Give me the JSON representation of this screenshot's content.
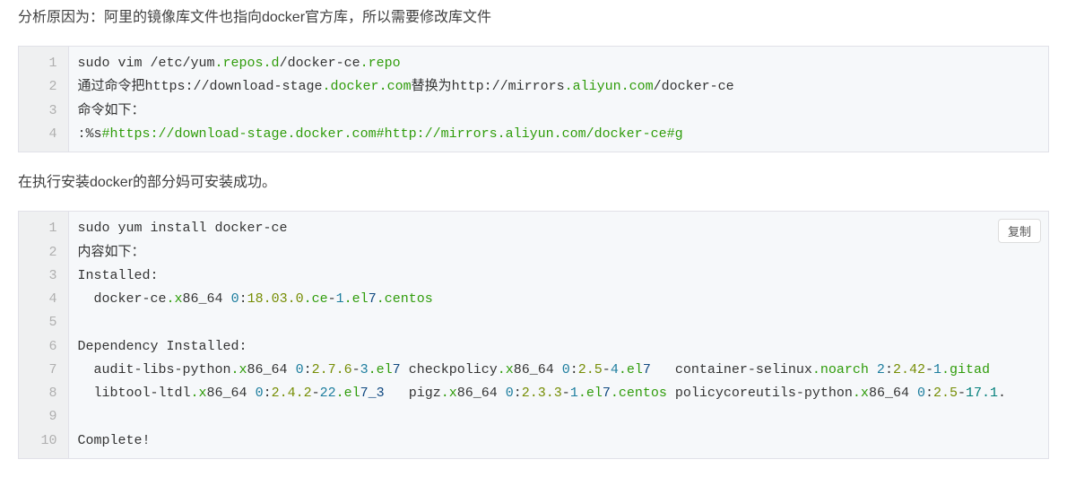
{
  "para1": "分析原因为：阿里的镜像库文件也指向docker官方库，所以需要修改库文件",
  "para2": "在执行安装docker的部分妈可安装成功。",
  "copy_label": "复制",
  "block1": {
    "lines": [
      [
        {
          "t": "sudo vim /etc/yum"
        },
        {
          "t": ".repos",
          "c": "t-green"
        },
        {
          "t": ".d",
          "c": "t-green"
        },
        {
          "t": "/docker-ce"
        },
        {
          "t": ".repo",
          "c": "t-green"
        }
      ],
      [
        {
          "t": "通过命令把https://download-stage"
        },
        {
          "t": ".docker",
          "c": "t-green"
        },
        {
          "t": ".com",
          "c": "t-green"
        },
        {
          "t": "替换为http://mirrors"
        },
        {
          "t": ".aliyun",
          "c": "t-green"
        },
        {
          "t": ".com",
          "c": "t-green"
        },
        {
          "t": "/docker-ce"
        }
      ],
      [
        {
          "t": "命令如下："
        }
      ],
      [
        {
          "t": ":%s"
        },
        {
          "t": "#https://download-stage.docker.com#http://mirrors.aliyun.com/docker-ce#g",
          "c": "t-comment"
        }
      ]
    ]
  },
  "block2": {
    "lines": [
      [
        {
          "t": "sudo yum install docker-ce"
        }
      ],
      [
        {
          "t": "内容如下："
        }
      ],
      [
        {
          "t": "Installed:"
        }
      ],
      [
        {
          "t": "  docker-ce"
        },
        {
          "t": ".x",
          "c": "t-green"
        },
        {
          "t": "86_64 "
        },
        {
          "t": "0",
          "c": "t-num"
        },
        {
          "t": ":"
        },
        {
          "t": "18.03",
          "c": "t-olive"
        },
        {
          "t": ".0",
          "c": "t-olive"
        },
        {
          "t": ".ce",
          "c": "t-green"
        },
        {
          "t": "-"
        },
        {
          "t": "1",
          "c": "t-num"
        },
        {
          "t": ".el",
          "c": "t-green"
        },
        {
          "t": "7",
          "c": "t-navy"
        },
        {
          "t": ".centos",
          "c": "t-green"
        }
      ],
      [
        {
          "t": " "
        }
      ],
      [
        {
          "t": "Dependency Installed:"
        }
      ],
      [
        {
          "t": "  audit-libs-python"
        },
        {
          "t": ".x",
          "c": "t-green"
        },
        {
          "t": "86_64 "
        },
        {
          "t": "0",
          "c": "t-num"
        },
        {
          "t": ":"
        },
        {
          "t": "2.7",
          "c": "t-olive"
        },
        {
          "t": ".6",
          "c": "t-olive"
        },
        {
          "t": "-"
        },
        {
          "t": "3",
          "c": "t-num"
        },
        {
          "t": ".el",
          "c": "t-green"
        },
        {
          "t": "7",
          "c": "t-navy"
        },
        {
          "t": " checkpolicy"
        },
        {
          "t": ".x",
          "c": "t-green"
        },
        {
          "t": "86_64 "
        },
        {
          "t": "0",
          "c": "t-num"
        },
        {
          "t": ":"
        },
        {
          "t": "2.5",
          "c": "t-olive"
        },
        {
          "t": "-"
        },
        {
          "t": "4",
          "c": "t-num"
        },
        {
          "t": ".el",
          "c": "t-green"
        },
        {
          "t": "7",
          "c": "t-navy"
        },
        {
          "t": "   container-selinux"
        },
        {
          "t": ".noarch",
          "c": "t-green"
        },
        {
          "t": " "
        },
        {
          "t": "2",
          "c": "t-num"
        },
        {
          "t": ":"
        },
        {
          "t": "2.42",
          "c": "t-olive"
        },
        {
          "t": "-"
        },
        {
          "t": "1",
          "c": "t-num"
        },
        {
          "t": ".gitad",
          "c": "t-green"
        }
      ],
      [
        {
          "t": "  libtool-ltdl"
        },
        {
          "t": ".x",
          "c": "t-green"
        },
        {
          "t": "86_64 "
        },
        {
          "t": "0",
          "c": "t-num"
        },
        {
          "t": ":"
        },
        {
          "t": "2.4",
          "c": "t-olive"
        },
        {
          "t": ".2",
          "c": "t-olive"
        },
        {
          "t": "-"
        },
        {
          "t": "22",
          "c": "t-num"
        },
        {
          "t": ".el",
          "c": "t-green"
        },
        {
          "t": "7_3",
          "c": "t-navy"
        },
        {
          "t": "   pigz"
        },
        {
          "t": ".x",
          "c": "t-green"
        },
        {
          "t": "86_64 "
        },
        {
          "t": "0",
          "c": "t-num"
        },
        {
          "t": ":"
        },
        {
          "t": "2.3",
          "c": "t-olive"
        },
        {
          "t": ".3",
          "c": "t-olive"
        },
        {
          "t": "-"
        },
        {
          "t": "1",
          "c": "t-num"
        },
        {
          "t": ".el",
          "c": "t-green"
        },
        {
          "t": "7",
          "c": "t-navy"
        },
        {
          "t": ".centos",
          "c": "t-green"
        },
        {
          "t": " policycoreutils-python"
        },
        {
          "t": ".x",
          "c": "t-green"
        },
        {
          "t": "86_64 "
        },
        {
          "t": "0",
          "c": "t-num"
        },
        {
          "t": ":"
        },
        {
          "t": "2.5",
          "c": "t-olive"
        },
        {
          "t": "-"
        },
        {
          "t": "17.1",
          "c": "t-teal"
        },
        {
          "t": "."
        }
      ],
      [
        {
          "t": " "
        }
      ],
      [
        {
          "t": "Complete!"
        }
      ]
    ]
  }
}
